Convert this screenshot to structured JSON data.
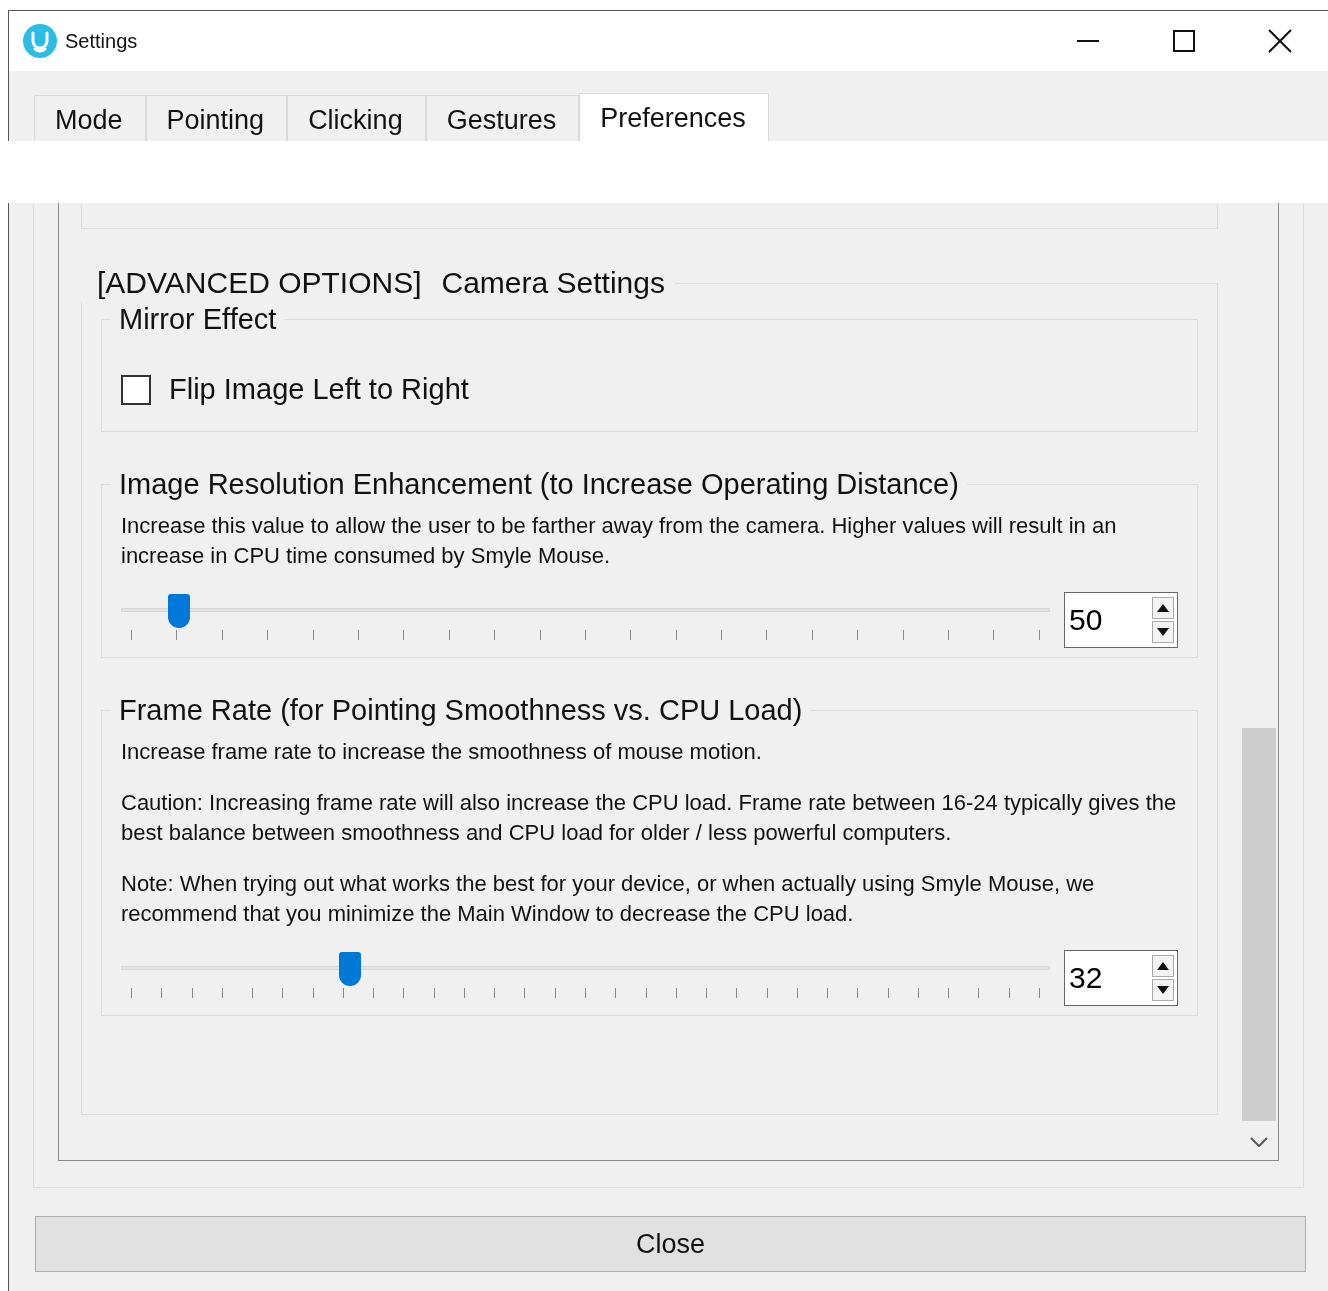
{
  "window": {
    "title": "Settings"
  },
  "tabs": [
    {
      "label": "Mode",
      "selected": false
    },
    {
      "label": "Pointing",
      "selected": false
    },
    {
      "label": "Clicking",
      "selected": false
    },
    {
      "label": "Gestures",
      "selected": false
    },
    {
      "label": "Preferences",
      "selected": true
    }
  ],
  "section": {
    "tag": "[ADVANCED OPTIONS]",
    "title": "Camera Settings",
    "groups": [
      {
        "kind": "checkbox",
        "title": "Mirror Effect",
        "checkbox": {
          "label": "Flip Image Left to Right",
          "checked": false
        }
      },
      {
        "kind": "slider",
        "title": "Image Resolution Enhancement (to Increase Operating Distance)",
        "paragraphs": [
          "Increase this value to allow the user to be farther away from the camera. Higher values will result in an increase in CPU time consumed by Smyle Mouse."
        ],
        "slider": {
          "level": 0.062
        },
        "spin": {
          "value": "50"
        }
      },
      {
        "kind": "slider",
        "title": "Frame Rate (for Pointing Smoothness vs. CPU Load)",
        "paragraphs": [
          "Increase frame rate to increase the smoothness of mouse motion.",
          "Caution: Increasing frame rate will also increase the CPU load. Frame rate between 16-24 typically gives the best balance between smoothness and CPU load for older / less powerful computers.",
          "Note: When trying out what works the best for your device, or when actually using Smyle Mouse, we recommend that you minimize the Main Window to decrease the CPU load."
        ],
        "slider": {
          "level": 0.246
        },
        "spin": {
          "value": "32"
        }
      }
    ]
  },
  "close_button": "Close"
}
